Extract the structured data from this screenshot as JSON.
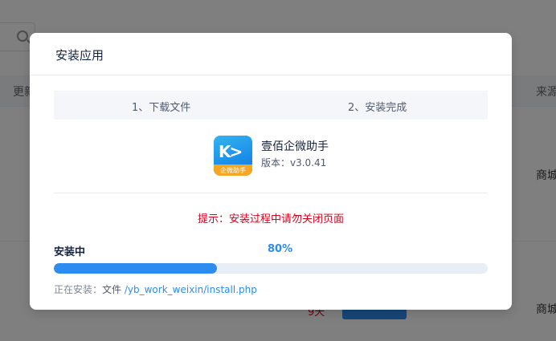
{
  "background": {
    "column_left": "更新",
    "column_right": "来源",
    "cell_1": "商城",
    "cell_2": "商城",
    "red_text": "9天"
  },
  "modal": {
    "title": "安装应用",
    "steps": [
      "1、下载文件",
      "2、安装完成"
    ],
    "app": {
      "name": "壹佰企微助手",
      "version": "版本：v3.0.41",
      "icon_strip_text": "企微助手"
    },
    "warning": "提示：安装过程中请勿关闭页面",
    "status_label": "安装中",
    "progress_percent_text": "80%",
    "progress_fill_fraction": 0.376,
    "info_prefix": "正在安装：",
    "info_file_label": "文件",
    "info_file_path": "/yb_work_weixin/install.php"
  },
  "colors": {
    "accent": "#2d8cf0",
    "warning": "#d9001b",
    "icon_strip": "#f5a623"
  }
}
